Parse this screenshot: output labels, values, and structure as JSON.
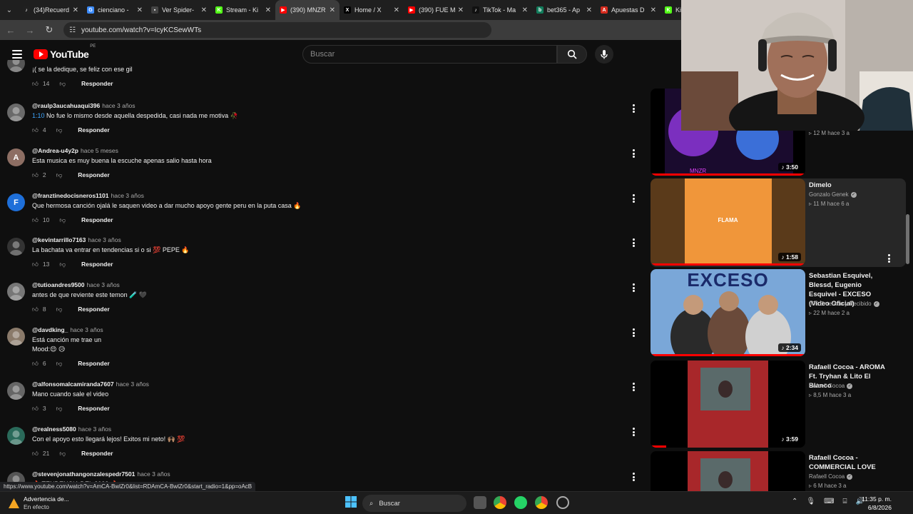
{
  "browser": {
    "tabs": [
      {
        "label": "(34)Recuerd",
        "color": "#202020",
        "glyph": "♪"
      },
      {
        "label": "cienciano -",
        "color": "#3c8cff",
        "glyph": "G"
      },
      {
        "label": "Ver Spider-",
        "color": "#444",
        "glyph": "▪"
      },
      {
        "label": "Stream - Ki",
        "color": "#53fc18",
        "glyph": "K"
      },
      {
        "label": "(390) MNZR",
        "color": "#ff0000",
        "glyph": "▶",
        "active": true
      },
      {
        "label": "Home / X",
        "color": "#000",
        "glyph": "X"
      },
      {
        "label": "(390) FUE M",
        "color": "#ff0000",
        "glyph": "▶"
      },
      {
        "label": "TikTok - Ma",
        "color": "#111",
        "glyph": "♪"
      },
      {
        "label": "bet365 - Ap",
        "color": "#127d5c",
        "glyph": "b"
      },
      {
        "label": "Apuestas D",
        "color": "#d52b1e",
        "glyph": "A"
      },
      {
        "label": "Ki",
        "color": "#53fc18",
        "glyph": "K"
      }
    ],
    "url": "youtube.com/watch?v=IcyKCSewWTs"
  },
  "header": {
    "logo_text": "YouTube",
    "country": "PE",
    "search_placeholder": "Buscar"
  },
  "comments": [
    {
      "handle": "",
      "when": "",
      "text": "¡( se la dedique, se feliz con ese gil",
      "likes": "14",
      "reply": "Responder",
      "avatar": "img",
      "avatar_color": "#555"
    },
    {
      "handle": "@raulp3aucahuaqui396",
      "when": "hace 3 años",
      "ts": "1:10",
      "text": " No fue lo mismo desde aquella despedida, casi nada me motiva 🥀",
      "likes": "4",
      "reply": "Responder",
      "avatar": "img",
      "avatar_color": "#6a6a6a"
    },
    {
      "handle": "@Andrea-u4y2p",
      "when": "hace 5 meses",
      "text": "Esta musica es muy buena la escuche apenas salio hasta hora",
      "likes": "2",
      "reply": "Responder",
      "avatar": "A",
      "avatar_color": "#8d6e63"
    },
    {
      "handle": "@franztinedocisneros1101",
      "when": "hace 3 años",
      "text": "Que hermosa canción ojalá le saquen video a dar mucho apoyo gente peru en la puta casa 🔥",
      "likes": "10",
      "reply": "Responder",
      "avatar": "F",
      "avatar_color": "#1e6fd9"
    },
    {
      "handle": "@kevintarrillo7163",
      "when": "hace 3 años",
      "text": "La bachata va entrar en tendencias si o si 💯 PEPE 🔥",
      "likes": "13",
      "reply": "Responder",
      "avatar": "img",
      "avatar_color": "#333"
    },
    {
      "handle": "@tutioandres9500",
      "when": "hace 3 años",
      "text": "antes de que reviente este temon 🧪 🖤",
      "likes": "8",
      "reply": "Responder",
      "avatar": "img",
      "avatar_color": "#777"
    },
    {
      "handle": "@davdking_",
      "when": "hace 3 años",
      "text": "Está canción me trae un",
      "text2": " Mood:😌 😥",
      "likes": "6",
      "reply": "Responder",
      "avatar": "img",
      "avatar_color": "#8a7a6a"
    },
    {
      "handle": "@alfonsomalcamiranda7607",
      "when": "hace 3 años",
      "text": "Mano cuando sale el video",
      "likes": "3",
      "reply": "Responder",
      "avatar": "img",
      "avatar_color": "#666"
    },
    {
      "handle": "@realness5080",
      "when": "hace 3 años",
      "text": "Con el apoyo esto llegará lejos! Exitos mi neto! 🙌🏽 💯",
      "likes": "21",
      "reply": "Responder",
      "avatar": "img",
      "avatar_color": "#2a6a5a"
    },
    {
      "handle": "@stevenjonathangonzalespedr7501",
      "when": "hace 3 años",
      "text": "🔥 TENDENCIA DEL 2023 🔥",
      "likes": "",
      "reply": "",
      "avatar": "img",
      "avatar_color": "#555"
    }
  ],
  "sidebar": [
    {
      "title": "",
      "channel": "",
      "stats": "12 M  hace 3 a",
      "duration": "3:50",
      "thumb_bg": "#1a0b2e"
    },
    {
      "title": "Dimelo",
      "channel": "Gonzalo Genek",
      "stats": "11 M  hace 6 a",
      "duration": "1:58",
      "thumb_text": "FLAMA",
      "thumb_bg": "#5a3a1a"
    },
    {
      "title": "Sebastian Esquivel, Blessd, Eugenio Esquivel - EXCESO (Video Oficial)",
      "channel": "005 Enterado y Recibido",
      "stats": "22 M  hace 2 a",
      "duration": "2:34",
      "thumb_text": "EXCESO",
      "thumb_bg": "#7aa7d8"
    },
    {
      "title": "Rafaell Cocoa - AROMA Ft. Tryhan & Lito El Blanco",
      "channel": "Rafaell Cocoa",
      "stats": "8,5 M  hace 3 a",
      "duration": "3:59",
      "thumb_bg": "#000"
    },
    {
      "title": "Rafaell Cocoa - COMMERCIAL LOVE",
      "channel": "Rafaell Cocoa",
      "stats": "6 M  hace 3 a",
      "duration": "",
      "thumb_bg": "#000"
    }
  ],
  "statusbar_url": "https://www.youtube.com/watch?v=AmCA-BwlZr0&list=RDAmCA-BwlZr0&start_radio=1&pp=oAcB",
  "taskbar": {
    "weather_line1": "Advertencia de...",
    "weather_line2": "En efecto",
    "search": "Buscar",
    "time": "11:35 p. m.",
    "date": "6/8/2026"
  }
}
